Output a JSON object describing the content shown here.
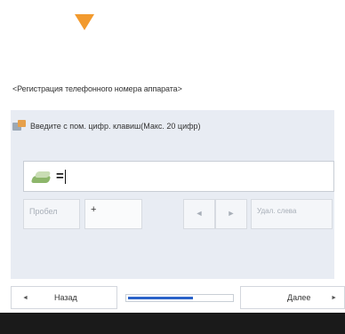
{
  "header": {
    "title": "<Регистрация телефонного номера аппарата>"
  },
  "instructions": {
    "icon": "keypad-icon",
    "text": "Введите с пом. цифр. клавиш(Макс. 20 цифр)"
  },
  "input": {
    "icon": "phone-icon",
    "value": "="
  },
  "buttons": {
    "space_label": "Пробел",
    "plus_label": "+",
    "left_label": "◄",
    "right_label": "►",
    "backspace_label": "Удал. слева"
  },
  "navigation": {
    "back_arrow": "◄",
    "back_label": "Назад",
    "next_label": "Далее",
    "next_arrow": "►",
    "progress_fraction": 0.63
  },
  "colors": {
    "accent_arrow": "#F29A2E",
    "panel_bg": "#E8ECF3",
    "progress_fill": "#2A62C9"
  }
}
